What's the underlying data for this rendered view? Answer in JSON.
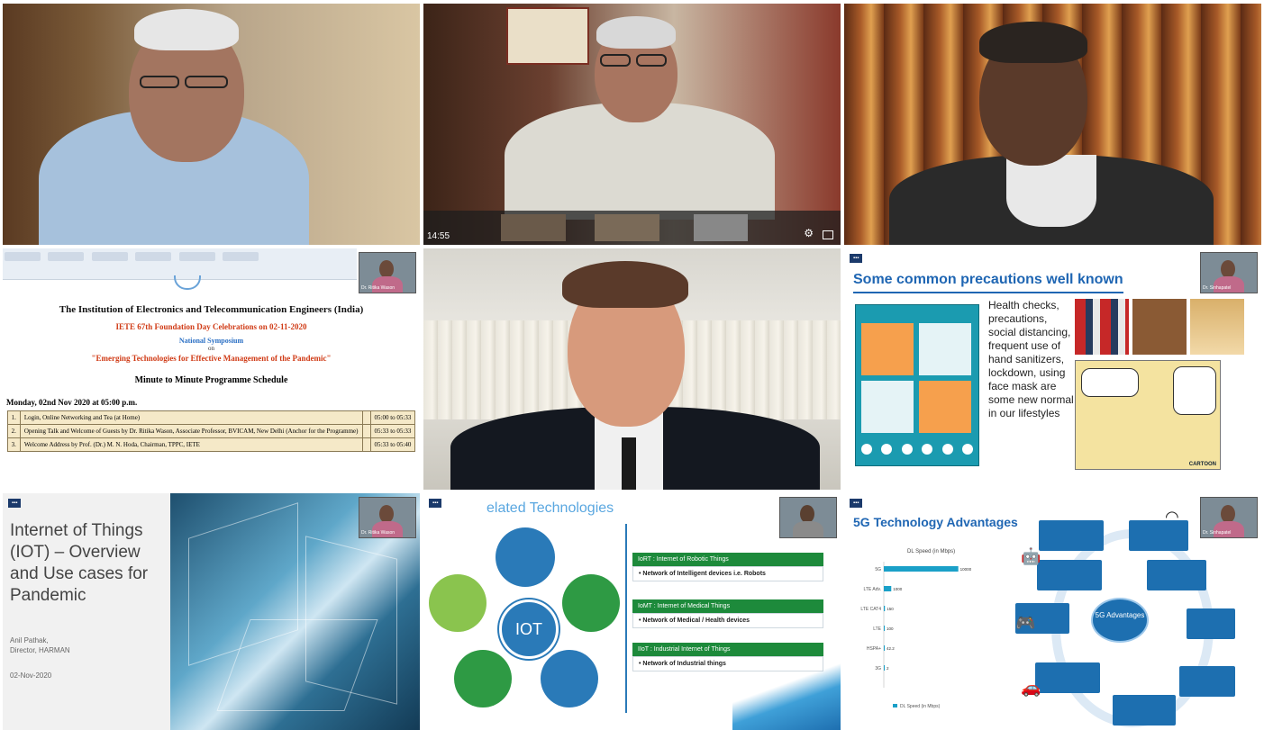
{
  "tiles": [
    {
      "id": "t1",
      "type": "video"
    },
    {
      "id": "t2",
      "type": "video",
      "timestamp": "14:55"
    },
    {
      "id": "t3",
      "type": "video"
    },
    {
      "id": "t4",
      "type": "slide-schedule",
      "org": "The Institution of Electronics and Telecommunication Engineers (India)",
      "event": "IETE 67th Foundation Day Celebrations on 02-11-2020",
      "sub1": "National Symposium",
      "sub2": "on",
      "theme": "\"Emerging Technologies for Effective Management of the Pandemic\"",
      "heading": "Minute to Minute Programme Schedule",
      "date": "Monday, 02nd Nov 2020 at 05:00 p.m.",
      "rows": [
        {
          "n": "1.",
          "item": "Login, Online Networking and Tea (at Home)",
          "time": "05:00 to 05:33"
        },
        {
          "n": "2.",
          "item": "Opening Talk and Welcome of Guests by Dr. Ritika Wason, Associate Professor, BVICAM, New Delhi (Anchor for the Programme)",
          "time": "05:33 to 05:33"
        },
        {
          "n": "3.",
          "item": "Welcome Address by Prof. (Dr.) M. N. Hoda, Chairman, TPPC, IETE",
          "time": "05:33 to 05:40"
        }
      ],
      "pip_label": "Dr. Ritika Wason"
    },
    {
      "id": "t5",
      "type": "video"
    },
    {
      "id": "t6",
      "type": "slide-precautions",
      "title": "Some common precautions well known",
      "body": "Health checks, precautions, social distancing, frequent use of hand sanitizers, lockdown, using face mask are some new normal in our lifestyles",
      "cartoon_brand": "CARTOON",
      "pip_label": "Dr. Sinhapatel"
    },
    {
      "id": "t7",
      "type": "slide-iot",
      "title": "Internet of Things (IOT) – Overview and Use cases for Pandemic",
      "author": "Anil Pathak,",
      "role": "Director, HARMAN",
      "date": "02-Nov-2020",
      "pip_label": "Dr. Ritika Wason"
    },
    {
      "id": "t8",
      "type": "slide-related",
      "title": "elated Technologies",
      "center": "IOT",
      "boxes": [
        {
          "head": "IoRT : Internet of Robotic Things",
          "body": "• Network of Intelligent devices i.e. Robots"
        },
        {
          "head": "IoMT : Internet of Medical Things",
          "body": "• Network of Medical / Health devices"
        },
        {
          "head": "IIoT : Industrial Internet of Things",
          "body": "• Network of Industrial things"
        }
      ]
    },
    {
      "id": "t9",
      "type": "slide-5g",
      "title": "5G Technology Advantages",
      "center": "5G Advantages",
      "pip_label": "Dr. Sinhapatel"
    }
  ],
  "chart_data": {
    "type": "bar",
    "title": "DL Speed (in Mbps)",
    "categories": [
      "5G",
      "LTE Adv.",
      "LTE CAT4",
      "LTE",
      "HSPA+",
      "3G"
    ],
    "values": [
      10000,
      1000,
      150,
      100,
      42.2,
      2
    ],
    "xlim": [
      0,
      15000
    ],
    "legend": "DL Speed (in Mbps)",
    "color": "#1aa0c8"
  }
}
